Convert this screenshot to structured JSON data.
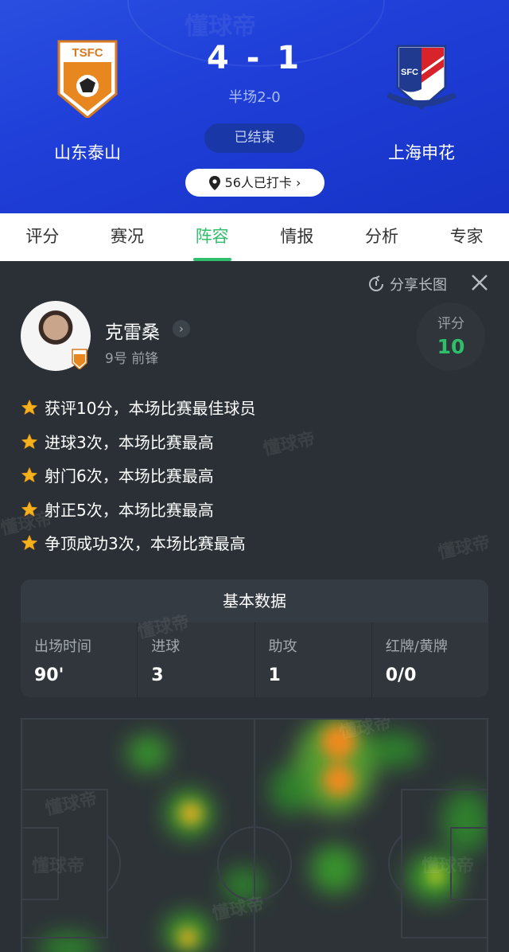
{
  "match": {
    "home_team": "山东泰山",
    "away_team": "上海申花",
    "score": "4 - 1",
    "halftime": "半场2-0",
    "status": "已结束",
    "checkin": "56人已打卡 ›",
    "home_logo_text": "TSFC",
    "away_logo_text": "SFC"
  },
  "tabs": [
    {
      "label": "评分"
    },
    {
      "label": "赛况"
    },
    {
      "label": "阵容"
    },
    {
      "label": "情报"
    },
    {
      "label": "分析"
    },
    {
      "label": "专家"
    }
  ],
  "card": {
    "share_label": "分享长图",
    "player": {
      "name": "克雷桑",
      "meta": "9号 前锋",
      "rating_label": "评分",
      "rating": "10"
    },
    "achievements": [
      "获评10分，本场比赛最佳球员",
      "进球3次，本场比赛最高",
      "射门6次，本场比赛最高",
      "射正5次，本场比赛最高",
      "争顶成功3次，本场比赛最高"
    ],
    "stats": {
      "title": "基本数据",
      "items": [
        {
          "label": "出场时间",
          "value": "90'"
        },
        {
          "label": "进球",
          "value": "3"
        },
        {
          "label": "助攻",
          "value": "1"
        },
        {
          "label": "红牌/黄牌",
          "value": "0/0"
        }
      ]
    },
    "watermark": "懂球帝"
  },
  "colors": {
    "header_blue": "#1f3fd8",
    "accent_green": "#2fbf6b",
    "card_bg": "#2b3036"
  },
  "icons": [
    "location-pin-icon",
    "share-icon",
    "close-icon",
    "star-icon",
    "chevron-right-icon"
  ]
}
